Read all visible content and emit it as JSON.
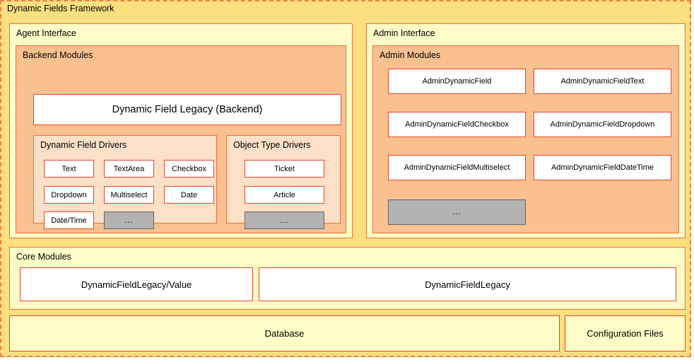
{
  "framework": {
    "title": "Dynamic Fields Framework",
    "colors": {
      "frame_bg": "#fcdf7f",
      "frame_border": "#ef8146",
      "interface_bg": "#fffcc8",
      "modules_bg": "#fac090",
      "drivers_bg": "#fce0c8",
      "box_border": "#e8472b",
      "box_bg": "#ffffff",
      "placeholder_bg": "#b3b3b3",
      "placeholder_border": "#666666"
    }
  },
  "agent_interface": {
    "title": "Agent Interface",
    "backend_modules": {
      "title": "Backend Modules",
      "legacy_backend": "Dynamic Field Legacy (Backend)",
      "dynamic_field_drivers": {
        "title": "Dynamic Field Drivers",
        "items": [
          "Text",
          "TextArea",
          "Checkbox",
          "Dropdown",
          "Multiselect",
          "Date",
          "Date/Time"
        ],
        "more": "..."
      },
      "object_type_drivers": {
        "title": "Object Type Drivers",
        "items": [
          "Ticket",
          "Article"
        ],
        "more": "..."
      }
    }
  },
  "admin_interface": {
    "title": "Admin Interface",
    "admin_modules": {
      "title": "Admin Modules",
      "items": [
        "AdminDynamicField",
        "AdminDynamicFieldText",
        "AdminDynamicFieldCheckbox",
        "AdminDynamicFieldDropdown",
        "AdminDynamicFieldMultiselect",
        "AdminDynamicFieldDateTime"
      ],
      "more": "..."
    }
  },
  "core_modules": {
    "title": "Core Modules",
    "items": [
      "DynamicFieldLegacy/Value",
      "DynamicFieldLegacy"
    ]
  },
  "storage": {
    "database": "Database",
    "configuration_files": "Configuration Files"
  }
}
